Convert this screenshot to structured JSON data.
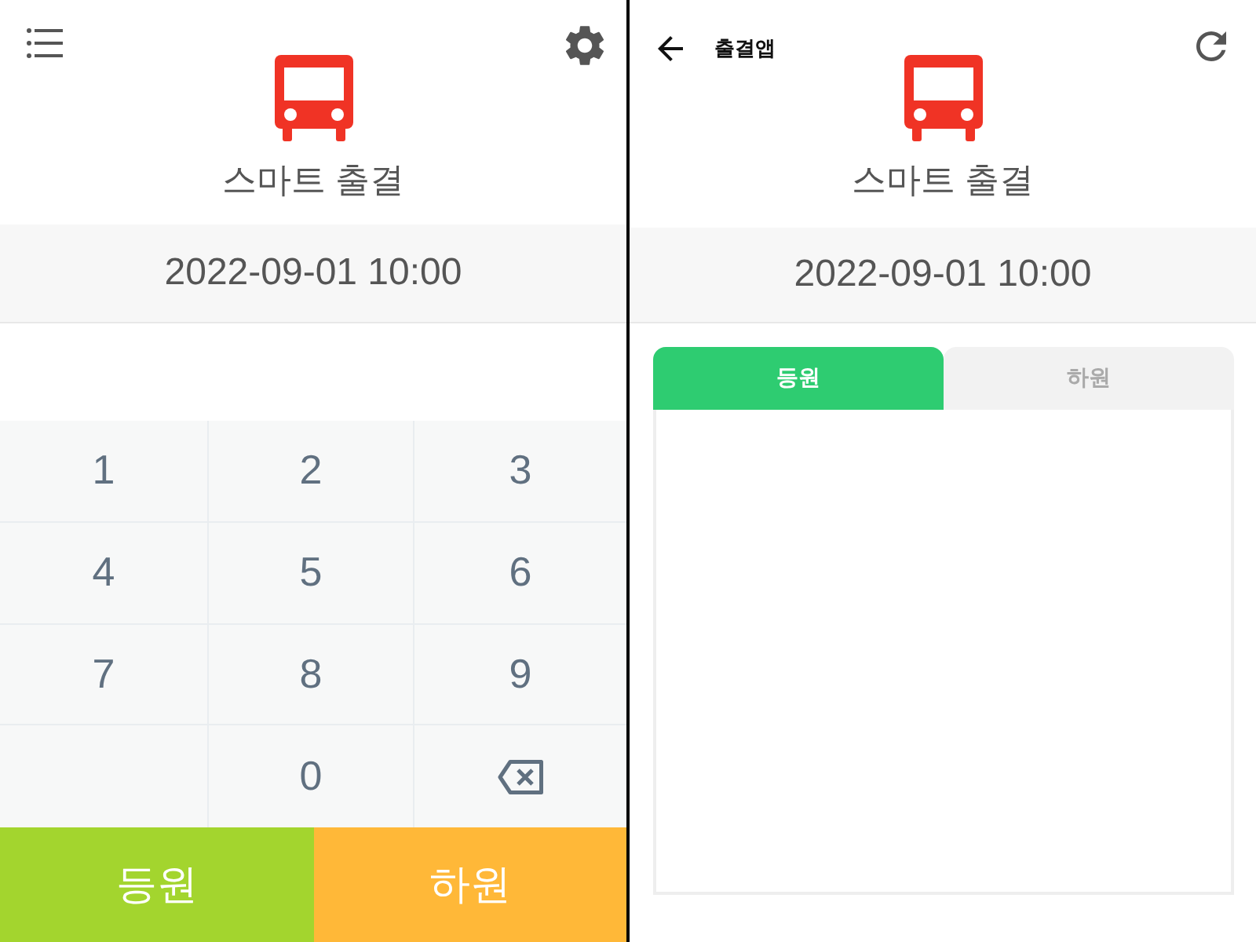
{
  "keypad_screen": {
    "app_title": "스마트 출결",
    "datetime": "2022-09-01 10:00",
    "keys": [
      {
        "kind": "digit",
        "label": "1"
      },
      {
        "kind": "digit",
        "label": "2"
      },
      {
        "kind": "digit",
        "label": "3"
      },
      {
        "kind": "digit",
        "label": "4"
      },
      {
        "kind": "digit",
        "label": "5"
      },
      {
        "kind": "digit",
        "label": "6"
      },
      {
        "kind": "digit",
        "label": "7"
      },
      {
        "kind": "digit",
        "label": "8"
      },
      {
        "kind": "digit",
        "label": "9"
      },
      {
        "kind": "blank"
      },
      {
        "kind": "digit",
        "label": "0"
      },
      {
        "kind": "backspace"
      }
    ],
    "action_buttons": [
      {
        "label": "등원",
        "color": "#a3d52e"
      },
      {
        "label": "하원",
        "color": "#ffb838"
      }
    ]
  },
  "attendance_screen": {
    "header_title": "출결앱",
    "app_title": "스마트 출결",
    "datetime": "2022-09-01 10:00",
    "tabs": [
      {
        "label": "등원",
        "selected": true
      },
      {
        "label": "하원",
        "selected": false
      }
    ]
  }
}
